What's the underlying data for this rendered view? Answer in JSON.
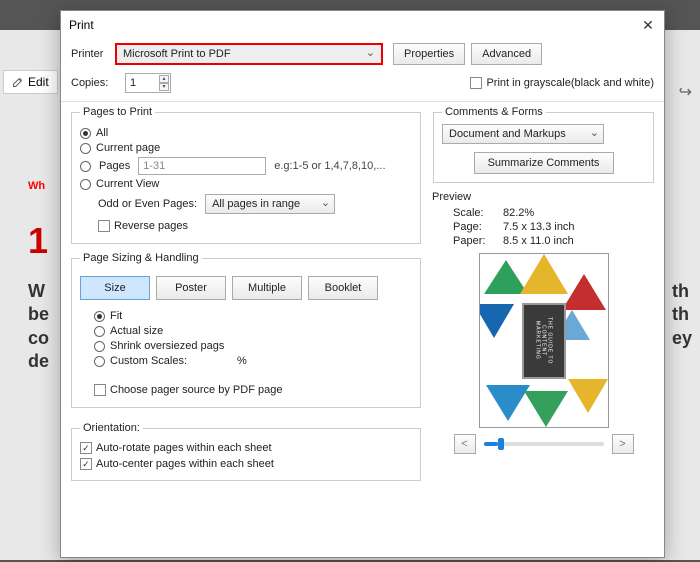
{
  "bg": {
    "edit": "Edit",
    "wh": "Wh",
    "num": "1",
    "para": "Wl be co de",
    "para2": "th th ey"
  },
  "dialog": {
    "title": "Print",
    "printer_label": "Printer",
    "printer_value": "Microsoft Print to PDF",
    "properties": "Properties",
    "advanced": "Advanced",
    "copies_label": "Copies:",
    "copies_value": "1",
    "grayscale": "Print in grayscale(black and white)"
  },
  "ptp": {
    "legend": "Pages to Print",
    "all": "All",
    "current": "Current page",
    "pages": "Pages",
    "pages_range": "1-31",
    "pages_hint": "e.g:1-5 or 1,4,7,8,10,...",
    "view": "Current View",
    "odd_label": "Odd or Even Pages:",
    "odd_value": "All pages in range",
    "reverse": "Reverse pages"
  },
  "sizing": {
    "legend": "Page Sizing & Handling",
    "size": "Size",
    "poster": "Poster",
    "multiple": "Multiple",
    "booklet": "Booklet",
    "fit": "Fit",
    "actual": "Actual size",
    "shrink": "Shrink oversiezed pags",
    "custom": "Custom Scales:",
    "pct": "%",
    "choose": "Choose pager source by PDF page"
  },
  "orient": {
    "legend": "Orientation:",
    "auto_rotate": "Auto-rotate pages within each sheet",
    "auto_center": "Auto-center pages within each sheet"
  },
  "comments": {
    "legend": "Comments & Forms",
    "value": "Document and Markups",
    "summarize": "Summarize Comments"
  },
  "preview": {
    "legend": "Preview",
    "scale_k": "Scale:",
    "scale_v": "82.2%",
    "page_k": "Page:",
    "page_v": "7.5 x 13.3 inch",
    "paper_k": "Paper:",
    "paper_v": "8.5 x 11.0 inch",
    "badge": "THE GUIDE TO CONTENT MARKETING",
    "prev": "<",
    "next": ">"
  }
}
